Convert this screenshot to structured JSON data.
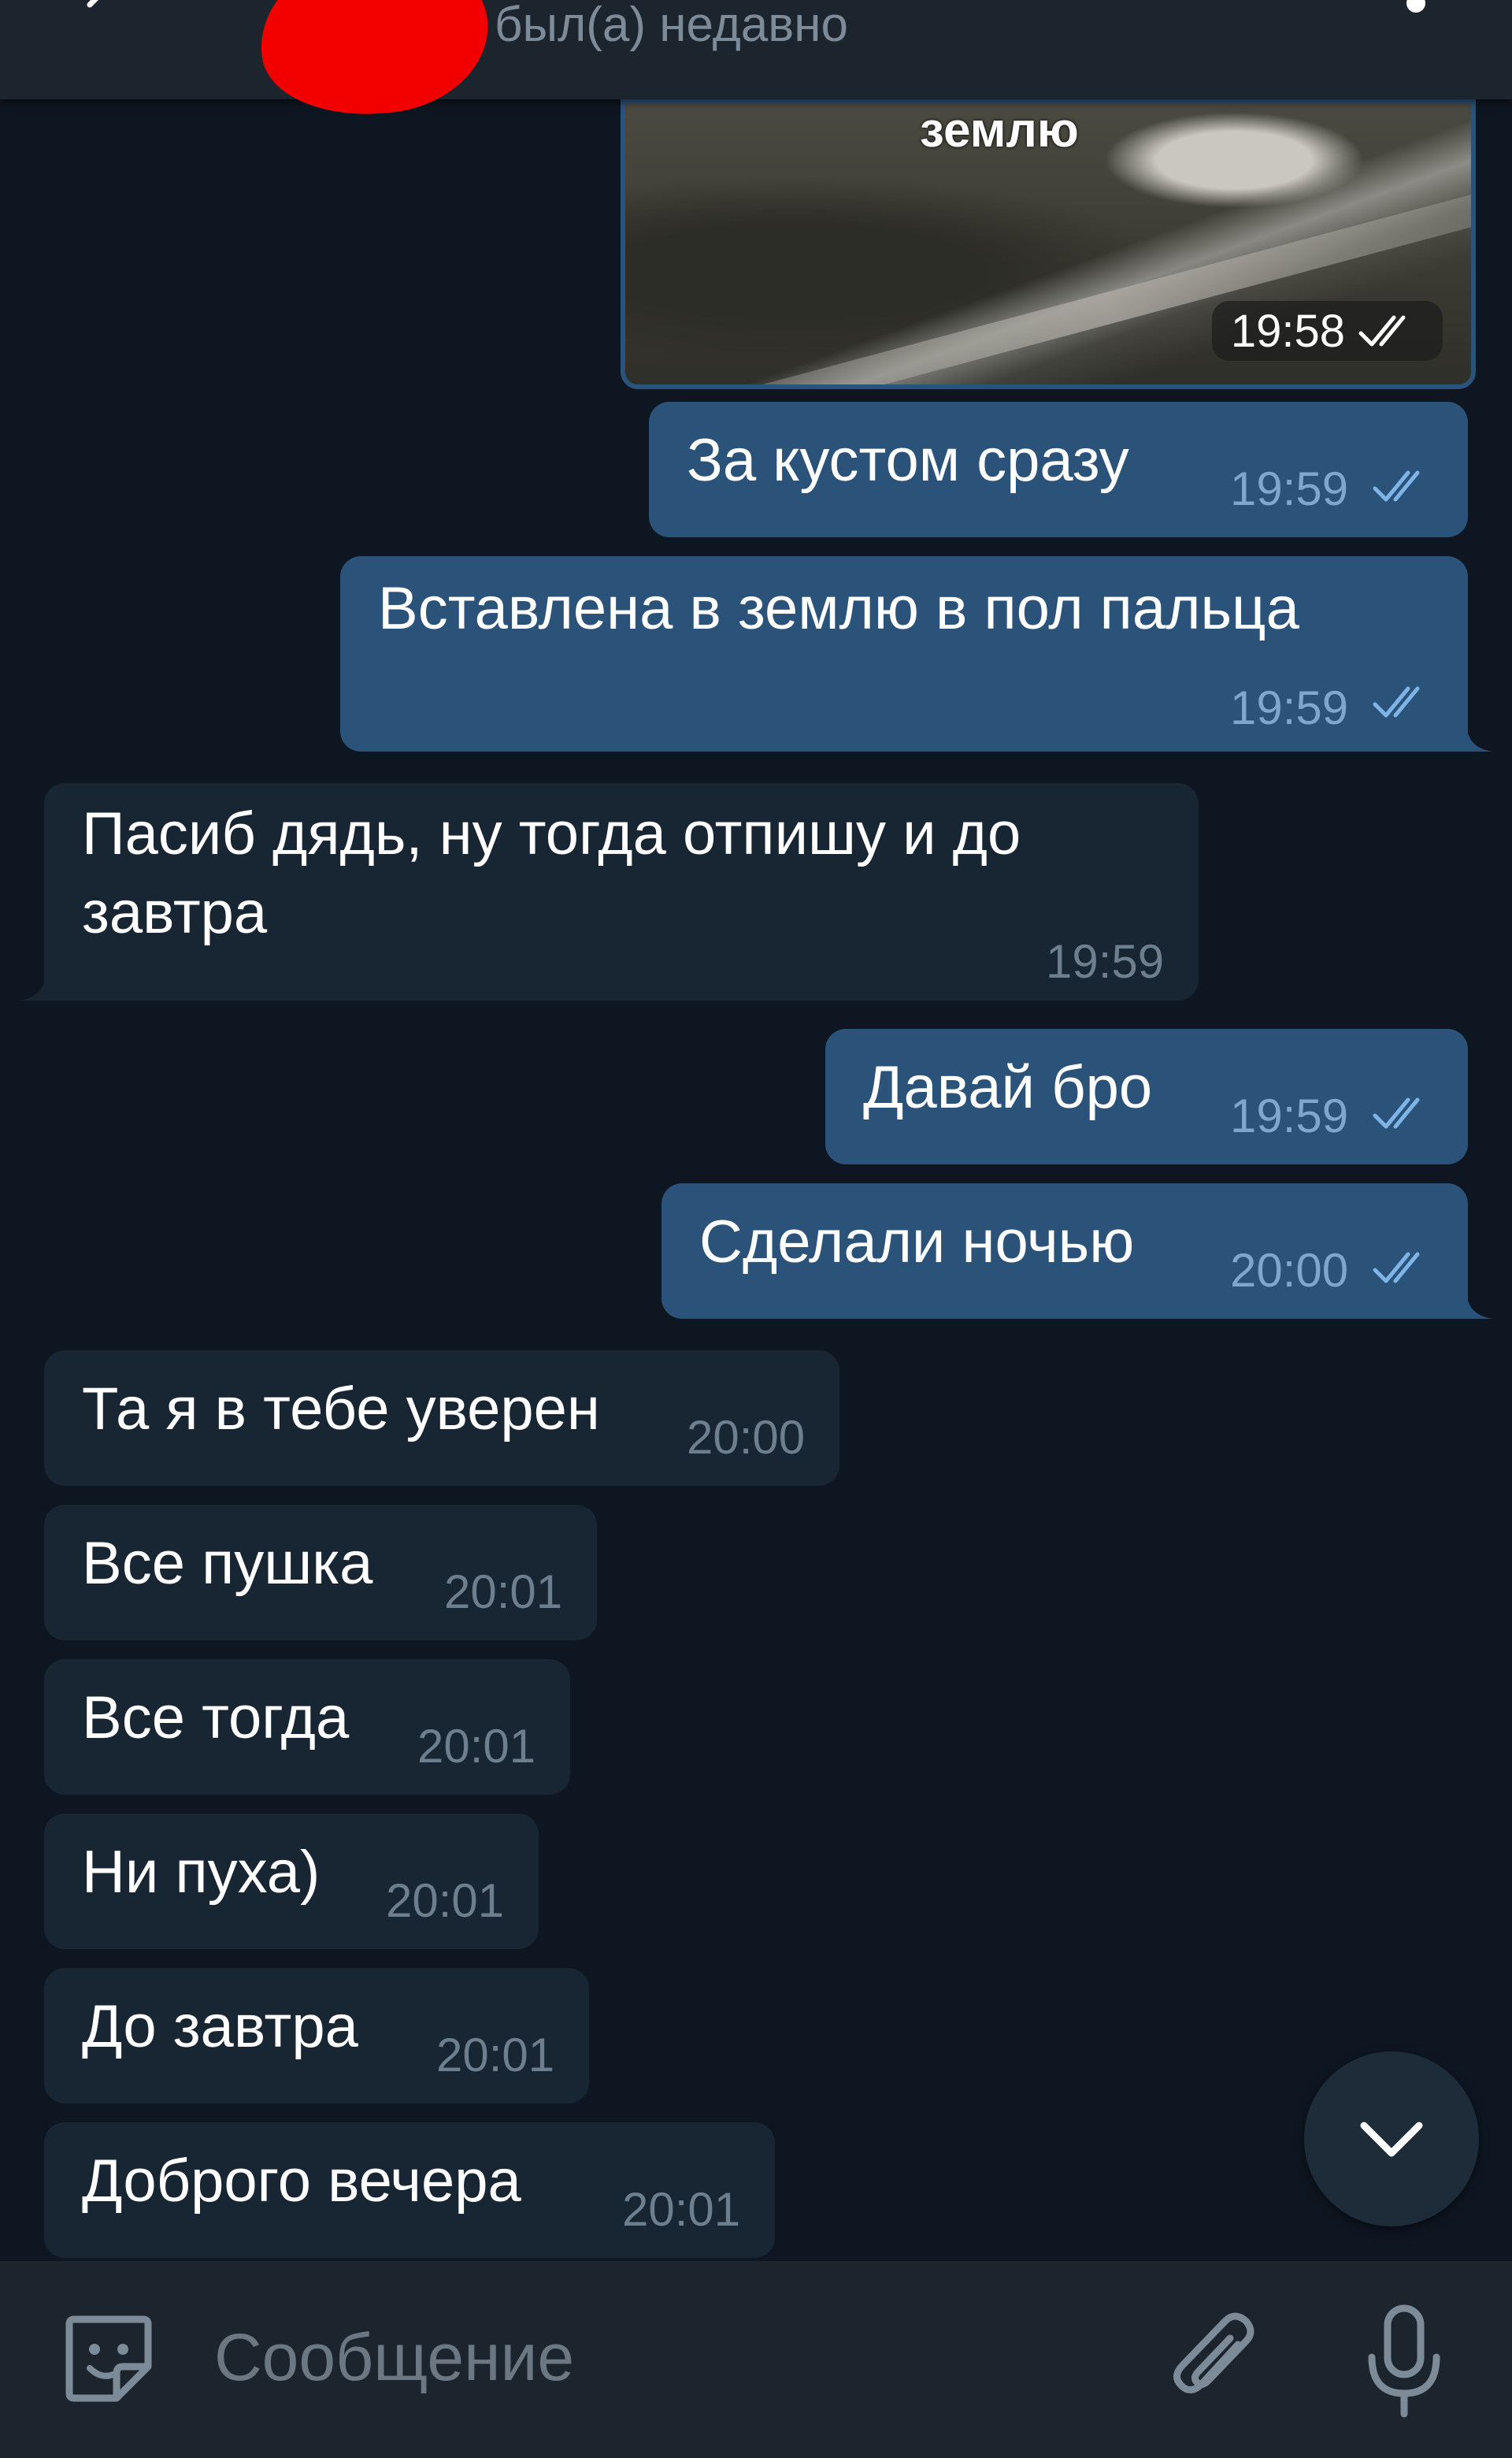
{
  "header": {
    "status": "был(а) недавно"
  },
  "photo": {
    "caption": "землю",
    "time": "19:58"
  },
  "messages": [
    {
      "dir": "out",
      "text": "За кустом сразу",
      "time": "19:59"
    },
    {
      "dir": "out",
      "lines": [
        "Вставлена в землю в пол пальца"
      ],
      "time": "19:59"
    },
    {
      "dir": "in",
      "lines": [
        "Пасиб дядь, ну тогда отпишу и до",
        "завтра"
      ],
      "time": "19:59"
    },
    {
      "dir": "out",
      "text": "Давай бро",
      "time": "19:59"
    },
    {
      "dir": "out",
      "text": "Сделали ночью",
      "time": "20:00"
    },
    {
      "dir": "in",
      "text": "Та я в тебе уверен",
      "time": "20:00"
    },
    {
      "dir": "in",
      "text": "Все пушка",
      "time": "20:01"
    },
    {
      "dir": "in",
      "text": "Все тогда",
      "time": "20:01"
    },
    {
      "dir": "in",
      "text": "Ни пуха)",
      "time": "20:01"
    },
    {
      "dir": "in",
      "text": "До завтра",
      "time": "20:01"
    },
    {
      "dir": "in",
      "text": "Доброго вечера",
      "time": "20:01"
    }
  ],
  "input": {
    "placeholder": "Сообщение"
  },
  "icons": {
    "back": "arrow-left-icon",
    "menu": "more-vertical-icon",
    "scroll_down": "chevron-down-icon",
    "sticker": "sticker-icon",
    "attach": "paperclip-icon",
    "mic": "microphone-icon",
    "read": "double-check-icon"
  },
  "colors": {
    "background": "#0e1621",
    "header": "#1c242d",
    "outgoing_bubble": "#2b5278",
    "incoming_bubble": "#182533",
    "outgoing_time": "#7fa6cc",
    "incoming_time": "#6d7f8f"
  }
}
